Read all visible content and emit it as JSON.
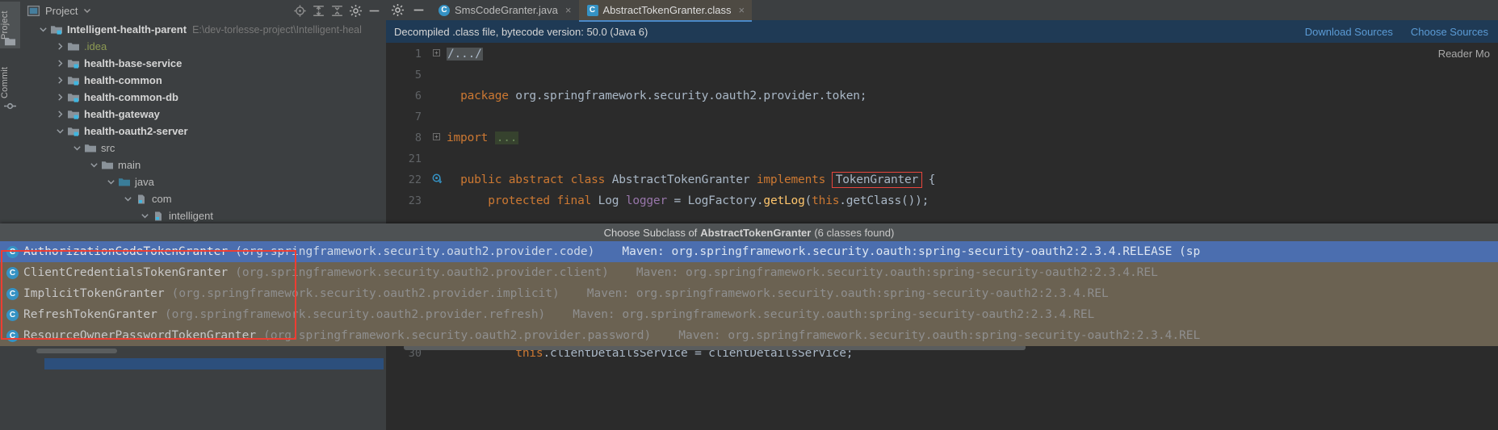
{
  "left_strip": {
    "tabs": [
      {
        "label": "Project",
        "icon": "project-icon"
      },
      {
        "label": "Commit",
        "icon": "commit-icon"
      }
    ]
  },
  "project_panel": {
    "header": {
      "title": "Project",
      "dropdown_icon": "chevron-down-icon",
      "panel_icon": "project-window-icon",
      "actions": [
        {
          "name": "select-opened-file-icon",
          "label": "Select Opened File"
        },
        {
          "name": "expand-all-icon",
          "label": "Expand All"
        },
        {
          "name": "collapse-all-icon",
          "label": "Collapse All"
        },
        {
          "name": "settings-gear-icon",
          "label": "Settings"
        },
        {
          "name": "hide-icon",
          "label": "Hide"
        }
      ]
    },
    "tree": [
      {
        "label": "Intelligent-health-parent",
        "path": "E:\\dev-torlesse-project\\Intelligent-heal",
        "indent": 0,
        "arrow": "down",
        "icon": "module-folder-icon",
        "bold": true
      },
      {
        "label": ".idea",
        "path": "",
        "indent": 1,
        "arrow": "right",
        "icon": "folder-icon",
        "bold": false,
        "color": "green"
      },
      {
        "label": "health-base-service",
        "path": "",
        "indent": 1,
        "arrow": "right",
        "icon": "module-folder-icon",
        "bold": true
      },
      {
        "label": "health-common",
        "path": "",
        "indent": 1,
        "arrow": "right",
        "icon": "module-folder-icon",
        "bold": true
      },
      {
        "label": "health-common-db",
        "path": "",
        "indent": 1,
        "arrow": "right",
        "icon": "module-folder-icon",
        "bold": true
      },
      {
        "label": "health-gateway",
        "path": "",
        "indent": 1,
        "arrow": "right",
        "icon": "module-folder-icon",
        "bold": true
      },
      {
        "label": "health-oauth2-server",
        "path": "",
        "indent": 1,
        "arrow": "down",
        "icon": "module-folder-icon",
        "bold": true
      },
      {
        "label": "src",
        "path": "",
        "indent": 2,
        "arrow": "down",
        "icon": "folder-icon",
        "bold": false
      },
      {
        "label": "main",
        "path": "",
        "indent": 3,
        "arrow": "down",
        "icon": "folder-icon",
        "bold": false
      },
      {
        "label": "java",
        "path": "",
        "indent": 4,
        "arrow": "down",
        "icon": "source-folder-icon",
        "bold": false
      },
      {
        "label": "com",
        "path": "",
        "indent": 5,
        "arrow": "down",
        "icon": "package-icon",
        "bold": false
      },
      {
        "label": "intelligent",
        "path": "",
        "indent": 6,
        "arrow": "down",
        "icon": "package-icon",
        "bold": false
      }
    ]
  },
  "editor": {
    "tabs": [
      {
        "label": "SmsCodeGranter.java",
        "icon": "java-class-icon",
        "active": false,
        "close": "×"
      },
      {
        "label": "AbstractTokenGranter.class",
        "icon": "compiled-class-icon",
        "active": true,
        "close": "×"
      }
    ],
    "toolbar": [
      {
        "name": "settings-gear-icon"
      },
      {
        "name": "minimize-icon"
      }
    ],
    "notification": {
      "message": "Decompiled .class file, bytecode version: 50.0 (Java 6)",
      "links": [
        "Download Sources",
        "Choose Sources"
      ]
    },
    "reader_mode_label": "Reader Mo",
    "lines": [
      {
        "num": "1",
        "fold": "+",
        "marker": "",
        "segments": [
          {
            "t": "/.../",
            "c": "gray-fold"
          }
        ]
      },
      {
        "num": "5",
        "fold": "",
        "marker": "",
        "segments": []
      },
      {
        "num": "6",
        "fold": "",
        "marker": "",
        "segments": [
          {
            "t": "  ",
            "c": ""
          },
          {
            "t": "package",
            "c": "kw"
          },
          {
            "t": " org.springframework.security.oauth2.provider.token;",
            "c": "ident"
          }
        ]
      },
      {
        "num": "7",
        "fold": "",
        "marker": "",
        "segments": []
      },
      {
        "num": "8",
        "fold": "+",
        "marker": "",
        "segments": [
          {
            "t": "import",
            "c": "kw"
          },
          {
            "t": " ",
            "c": ""
          },
          {
            "t": "...",
            "c": "green-fold"
          }
        ]
      },
      {
        "num": "21",
        "fold": "",
        "marker": "",
        "segments": []
      },
      {
        "num": "22",
        "fold": "",
        "marker": "run",
        "segments": [
          {
            "t": "  ",
            "c": ""
          },
          {
            "t": "public",
            "c": "kw"
          },
          {
            "t": " ",
            "c": ""
          },
          {
            "t": "abstract",
            "c": "kw"
          },
          {
            "t": " ",
            "c": ""
          },
          {
            "t": "class",
            "c": "kw"
          },
          {
            "t": " AbstractTokenGranter ",
            "c": "ident"
          },
          {
            "t": "implements",
            "c": "kw"
          },
          {
            "t": " ",
            "c": ""
          },
          {
            "t": "TokenGranter",
            "c": "ident hl-box"
          },
          {
            "t": " {",
            "c": "ident"
          }
        ]
      },
      {
        "num": "23",
        "fold": "",
        "marker": "",
        "segments": [
          {
            "t": "      ",
            "c": ""
          },
          {
            "t": "protected",
            "c": "kw"
          },
          {
            "t": " ",
            "c": ""
          },
          {
            "t": "final",
            "c": "kw"
          },
          {
            "t": " Log ",
            "c": "ident"
          },
          {
            "t": "logger",
            "c": "purple"
          },
          {
            "t": " = LogFactory.",
            "c": "ident"
          },
          {
            "t": "getLog",
            "c": "ylw"
          },
          {
            "t": "(",
            "c": "ident"
          },
          {
            "t": "this",
            "c": "kw"
          },
          {
            "t": ".getClass());",
            "c": "ident"
          }
        ]
      }
    ],
    "bottom_lines": [
      {
        "num": "30",
        "segments": [
          {
            "t": "          ",
            "c": ""
          },
          {
            "t": "this",
            "c": "kw"
          },
          {
            "t": ".clientDetailsService = clientDetailsService;",
            "c": "ident"
          }
        ]
      }
    ]
  },
  "popup": {
    "title_prefix": "Choose Subclass of",
    "title_class": "AbstractTokenGranter",
    "title_count": "(6 classes found)",
    "items": [
      {
        "name": "AuthorizationCodeTokenGranter",
        "package": "(org.springframework.security.oauth2.provider.code)",
        "maven": "Maven: org.springframework.security.oauth:spring-security-oauth2:2.3.4.RELEASE (sp",
        "selected": true,
        "icon": "class-icon"
      },
      {
        "name": "ClientCredentialsTokenGranter",
        "package": "(org.springframework.security.oauth2.provider.client)",
        "maven": "Maven: org.springframework.security.oauth:spring-security-oauth2:2.3.4.REL",
        "selected": false,
        "icon": "class-icon"
      },
      {
        "name": "ImplicitTokenGranter",
        "package": "(org.springframework.security.oauth2.provider.implicit)",
        "maven": "Maven: org.springframework.security.oauth:spring-security-oauth2:2.3.4.REL",
        "selected": false,
        "icon": "class-icon"
      },
      {
        "name": "RefreshTokenGranter",
        "package": "(org.springframework.security.oauth2.provider.refresh)",
        "maven": "Maven: org.springframework.security.oauth:spring-security-oauth2:2.3.4.REL",
        "selected": false,
        "icon": "class-icon"
      },
      {
        "name": "ResourceOwnerPasswordTokenGranter",
        "package": "(org.springframework.security.oauth2.provider.password)",
        "maven": "Maven: org.springframework.security.oauth:spring-security-oauth2:2.3.4.REL",
        "selected": false,
        "icon": "class-icon"
      }
    ]
  },
  "colors": {
    "accent_blue": "#4b6eaf",
    "highlight_red": "#ee3d32",
    "keyword_orange": "#cc7832",
    "panel_bg": "#3c3f41",
    "editor_bg": "#2b2b2b",
    "popup_bg": "#6b6252"
  }
}
